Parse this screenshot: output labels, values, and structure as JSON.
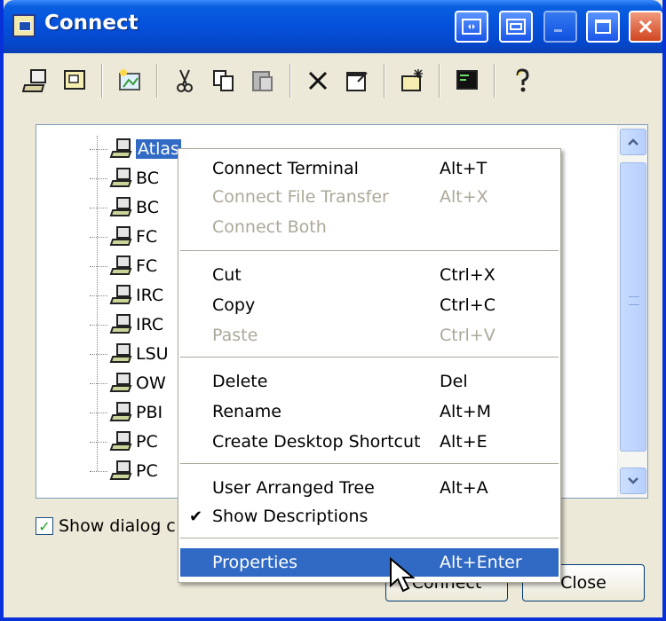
{
  "window": {
    "title": "Connect",
    "buttons": [
      "restore-icon",
      "tile-icon",
      "minimize-icon",
      "maximize-icon",
      "close-icon"
    ]
  },
  "toolbar": {
    "icons": [
      "new-connection-icon",
      "new-folder-icon",
      "wizard-icon",
      "cut-icon",
      "copy-icon",
      "paste-icon",
      "delete-icon",
      "properties-icon",
      "shortcut-icon",
      "terminal-icon",
      "help-icon"
    ]
  },
  "tree": {
    "items": [
      {
        "label": "Atlas",
        "selected": true
      },
      {
        "label": "BC"
      },
      {
        "label": "BC"
      },
      {
        "label": "FC"
      },
      {
        "label": "FC"
      },
      {
        "label": "IRC"
      },
      {
        "label": "IRC"
      },
      {
        "label": "LSU"
      },
      {
        "label": "OW"
      },
      {
        "label": "PBI"
      },
      {
        "label": "PC"
      },
      {
        "label": "PC"
      }
    ]
  },
  "footer": {
    "checkbox_label": "Show dialog c",
    "checkbox_checked": true,
    "connect_label": "Connect",
    "close_label": "Close"
  },
  "context_menu": {
    "items": [
      {
        "label": "Connect Terminal",
        "shortcut": "Alt+T",
        "disabled": false
      },
      {
        "label": "Connect File Transfer",
        "shortcut": "Alt+X",
        "disabled": true
      },
      {
        "label": "Connect Both",
        "shortcut": "",
        "disabled": true
      },
      {
        "label": "Cut",
        "shortcut": "Ctrl+X",
        "disabled": false
      },
      {
        "label": "Copy",
        "shortcut": "Ctrl+C",
        "disabled": false
      },
      {
        "label": "Paste",
        "shortcut": "Ctrl+V",
        "disabled": true
      },
      {
        "label": "Delete",
        "shortcut": "Del",
        "disabled": false
      },
      {
        "label": "Rename",
        "shortcut": "Alt+M",
        "disabled": false
      },
      {
        "label": "Create Desktop Shortcut",
        "shortcut": "Alt+E",
        "disabled": false
      },
      {
        "label": "User Arranged Tree",
        "shortcut": "Alt+A",
        "disabled": false
      },
      {
        "label": "Show Descriptions",
        "shortcut": "",
        "checked": true
      },
      {
        "label": "Properties",
        "shortcut": "Alt+Enter",
        "highlighted": true
      }
    ]
  },
  "colors": {
    "titlebar": "#0552dc",
    "highlight": "#316ac5",
    "dialog_bg": "#ece9d8",
    "disabled_text": "#aca899"
  }
}
